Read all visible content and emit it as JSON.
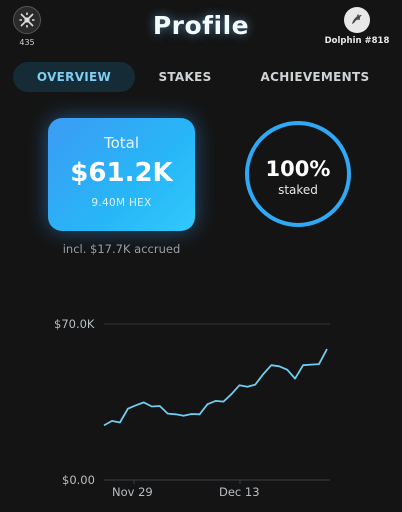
{
  "header": {
    "left_badge": {
      "count": "435",
      "icon": "token-logo-icon"
    },
    "title": "Profile",
    "user": {
      "name": "Dolphin #818",
      "icon": "dolphin-icon"
    }
  },
  "tabs": [
    {
      "label": "OVERVIEW",
      "active": true
    },
    {
      "label": "STAKES",
      "active": false
    },
    {
      "label": "ACHIEVEMENTS",
      "active": false
    }
  ],
  "total_card": {
    "label": "Total",
    "value": "$61.2K",
    "hex_amount": "9.40M HEX",
    "accrued_note": "incl. $17.7K accrued"
  },
  "staked": {
    "percent_text": "100%",
    "label": "staked",
    "fraction": 1.0
  },
  "colors": {
    "background": "#141414",
    "accent": "#2fa9f5",
    "line": "#6fcdf0",
    "tab_active_text": "#7fcdf2"
  },
  "chart_data": {
    "type": "line",
    "y_ticks": [
      "$70.0K",
      "$0.00"
    ],
    "ylim": [
      0,
      70000
    ],
    "x_ticks": [
      "Nov 29",
      "Dec 13"
    ],
    "series": [
      {
        "values": [
          24500,
          26500,
          25800,
          32000,
          33500,
          34800,
          33000,
          33200,
          29800,
          29500,
          28800,
          29600,
          29500,
          34000,
          35500,
          35200,
          38500,
          42500,
          41800,
          42800,
          47500,
          51500,
          51000,
          49500,
          45500,
          51500,
          51800,
          52000,
          58800
        ]
      }
    ]
  }
}
